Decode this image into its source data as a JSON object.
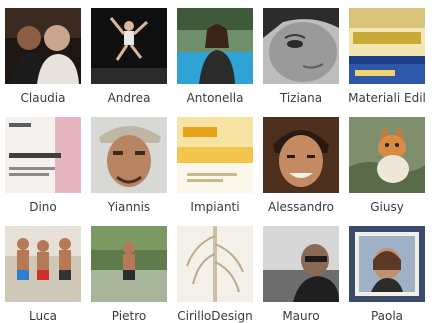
{
  "friends": [
    {
      "name": "Claudia",
      "photo": "photo-two-people-dark"
    },
    {
      "name": "Andrea",
      "photo": "photo-person-jumping"
    },
    {
      "name": "Antonella",
      "photo": "photo-woman-pool"
    },
    {
      "name": "Tiziana",
      "photo": "photo-face-closeup-bw"
    },
    {
      "name": "Materiali Edil",
      "photo": "photo-shop-sign"
    },
    {
      "name": "Dino",
      "photo": "photo-architecture-card"
    },
    {
      "name": "Yiannis",
      "photo": "photo-man-cap"
    },
    {
      "name": "Impianti",
      "photo": "photo-company-card"
    },
    {
      "name": "Alessandro",
      "photo": "photo-man-smiling"
    },
    {
      "name": "Giusy",
      "photo": "photo-cat"
    },
    {
      "name": "Luca",
      "photo": "photo-people-beach"
    },
    {
      "name": "Pietro",
      "photo": "photo-man-river"
    },
    {
      "name": "CirilloDesign",
      "photo": "photo-design-lamp"
    },
    {
      "name": "Mauro",
      "photo": "photo-man-sunglasses"
    },
    {
      "name": "Paola",
      "photo": "photo-woman-frame"
    }
  ]
}
